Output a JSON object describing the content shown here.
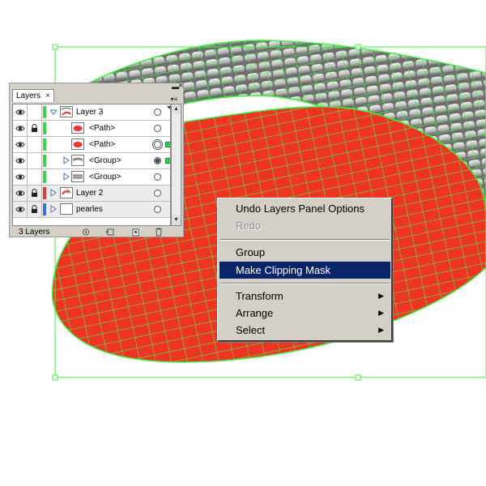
{
  "layers_panel": {
    "tab_label": "Layers",
    "close_glyph": "×",
    "minimize_glyph": "▬",
    "rows": [
      {
        "label": "Layer 3",
        "stripe": "#3dd64a",
        "locked": false,
        "expanded": true,
        "thumb": "layer3"
      },
      {
        "label": "<Path>",
        "stripe": "#3dd64a",
        "locked": true,
        "thumb": "red-path"
      },
      {
        "label": "<Path>",
        "stripe": "#3dd64a",
        "locked": false,
        "thumb": "red-path"
      },
      {
        "label": "<Group>",
        "stripe": "#3dd64a",
        "locked": false,
        "thumb": "group-a"
      },
      {
        "label": "<Group>",
        "stripe": "#3dd64a",
        "locked": false,
        "thumb": "group-b"
      },
      {
        "label": "Layer 2",
        "stripe": "#e13a3a",
        "locked": true,
        "thumb": "layer2"
      },
      {
        "label": "pearles",
        "stripe": "#3a6fe1",
        "locked": true,
        "thumb": "blank"
      }
    ],
    "footer_count": "3 Layers"
  },
  "context_menu": {
    "items": [
      {
        "label": "Undo Layers Panel Options",
        "state": "normal"
      },
      {
        "label": "Redo",
        "state": "disabled"
      },
      {
        "label": "Group",
        "state": "normal"
      },
      {
        "label": "Make Clipping Mask",
        "state": "highlighted"
      },
      {
        "label": "Transform",
        "state": "normal",
        "submenu": true
      },
      {
        "label": "Arrange",
        "state": "normal",
        "submenu": true
      },
      {
        "label": "Select",
        "state": "normal",
        "submenu": true
      }
    ],
    "submenu_glyph": "▶"
  },
  "colors": {
    "selection_green": "#3ef03e",
    "shape_red": "#ee3524",
    "menu_highlight": "#0a246a",
    "panel_gray": "#d4d0c8"
  }
}
